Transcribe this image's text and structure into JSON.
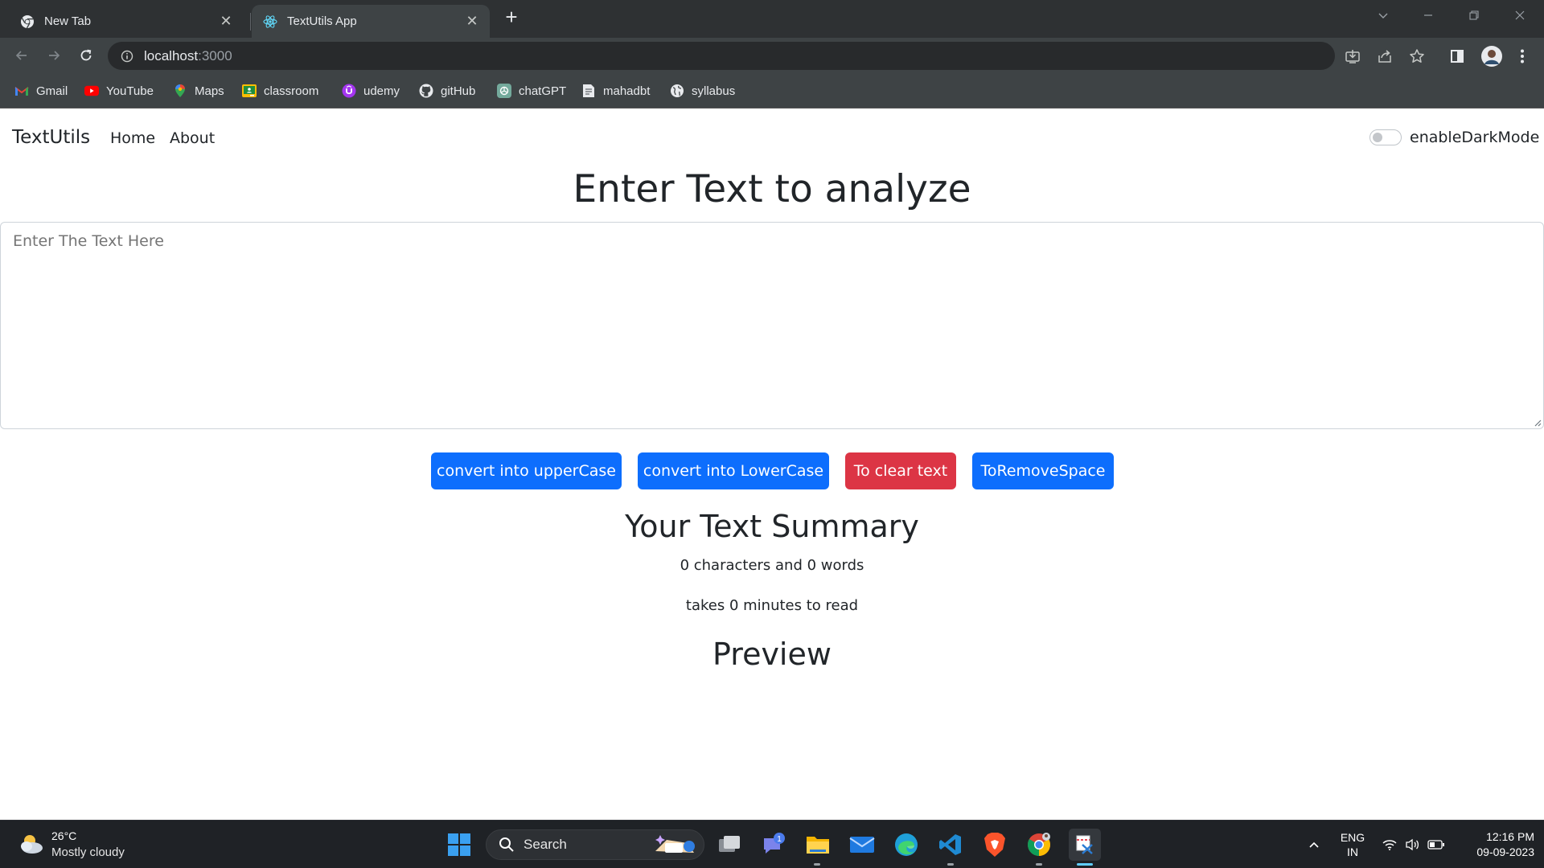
{
  "browser": {
    "tabs": [
      {
        "title": "New Tab",
        "active": false
      },
      {
        "title": "TextUtils App",
        "active": true
      }
    ],
    "url_host": "localhost",
    "url_port": ":3000",
    "bookmarks": [
      "Gmail",
      "YouTube",
      "Maps",
      "classroom",
      "udemy",
      "gitHub",
      "chatGPT",
      "mahadbt",
      "syllabus"
    ]
  },
  "navbar": {
    "brand": "TextUtils",
    "links": [
      "Home",
      "About"
    ],
    "dark_mode_label": "enableDarkMode",
    "dark_mode_enabled": false
  },
  "main": {
    "heading": "Enter Text to analyze",
    "textarea_placeholder": "Enter The Text Here",
    "textarea_value": "",
    "buttons": [
      {
        "label": "convert into upperCase",
        "variant": "primary"
      },
      {
        "label": "convert into LowerCase",
        "variant": "primary"
      },
      {
        "label": "To clear text",
        "variant": "danger"
      },
      {
        "label": "ToRemoveSpace",
        "variant": "primary"
      }
    ],
    "summary_heading": "Your Text Summary",
    "summary_counts": "0 characters and 0 words",
    "summary_read_time": "takes 0 minutes to read",
    "preview_heading": "Preview"
  },
  "taskbar": {
    "weather_temp": "26°C",
    "weather_desc": "Mostly cloudy",
    "search_label": "Search",
    "chat_badge": "1",
    "lang_primary": "ENG",
    "lang_secondary": "IN",
    "time": "12:16 PM",
    "date": "09-09-2023"
  },
  "colors": {
    "primary": "#0d6efd",
    "danger": "#dc3545",
    "chrome_dark": "#3e4345",
    "taskbar": "#1f2226"
  }
}
